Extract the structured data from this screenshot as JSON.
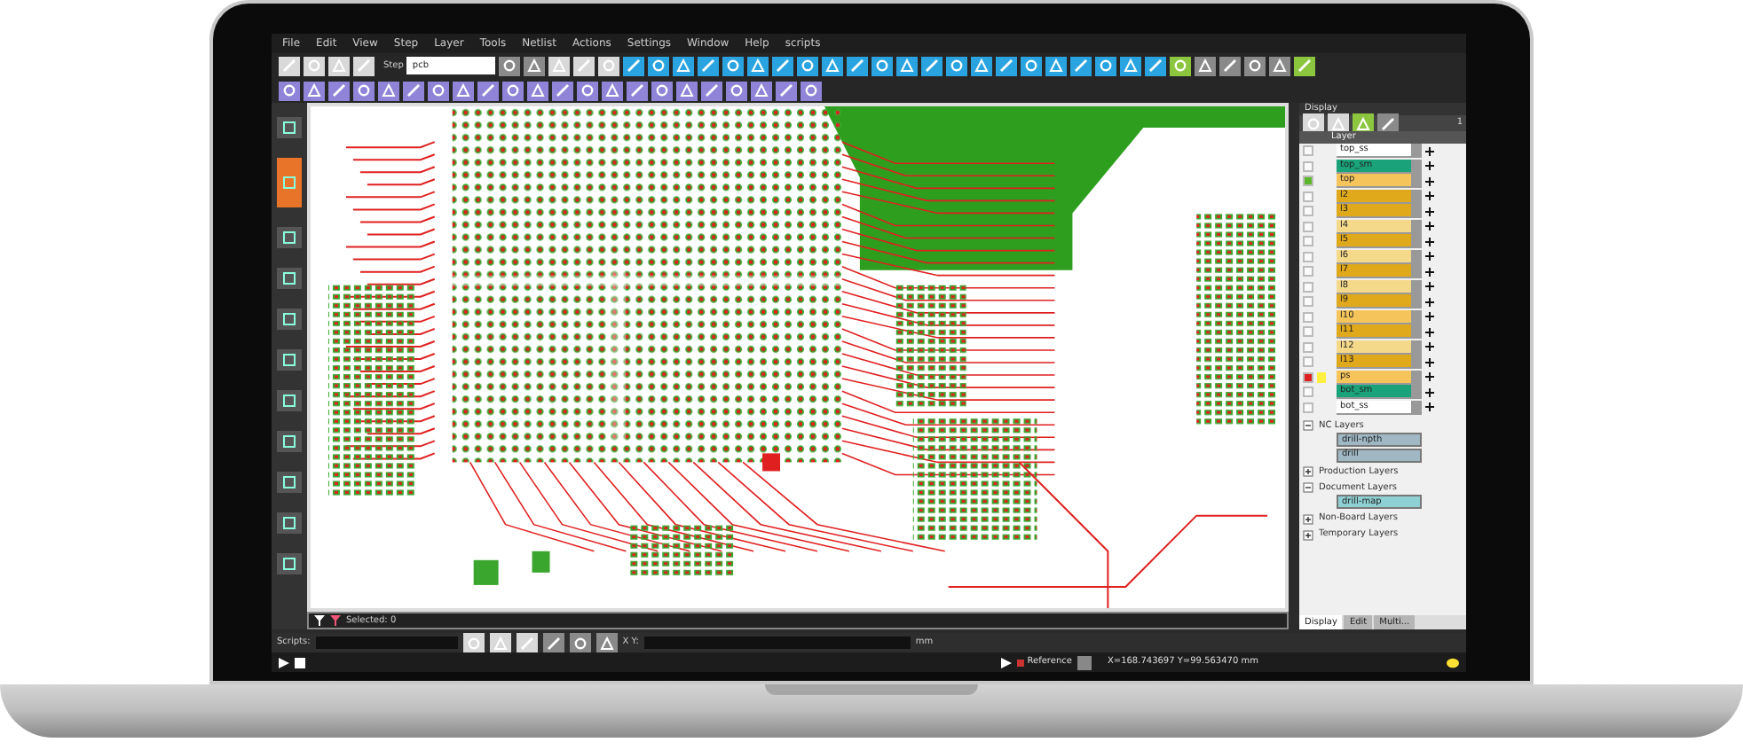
{
  "menu": [
    "File",
    "Edit",
    "View",
    "Step",
    "Layer",
    "Tools",
    "Netlist",
    "Actions",
    "Settings",
    "Window",
    "Help",
    "scripts"
  ],
  "step": {
    "label": "Step",
    "value": "pcb"
  },
  "left_toolbar": [
    {
      "selected": false
    },
    {
      "selected": true
    },
    {
      "selected": false
    },
    {
      "selected": false
    },
    {
      "selected": false
    },
    {
      "selected": false
    },
    {
      "selected": false
    },
    {
      "selected": false
    },
    {
      "selected": false
    },
    {
      "selected": false
    },
    {
      "selected": false
    }
  ],
  "panel": {
    "title": "Display",
    "layer_header": "Layer",
    "count": "1",
    "layers": [
      {
        "name": "top_ss",
        "color": "#ffffff",
        "work": false,
        "affected": false
      },
      {
        "name": "top_sm",
        "color": "#1aa37a",
        "work": false,
        "affected": false
      },
      {
        "name": "top",
        "color": "#f5c45a",
        "work": true,
        "affected": false
      },
      {
        "name": "l2",
        "color": "#e0a91c",
        "work": false,
        "affected": false
      },
      {
        "name": "l3",
        "color": "#e0a91c",
        "work": false,
        "affected": false
      },
      {
        "name": "l4",
        "color": "#f5d98a",
        "work": false,
        "affected": false
      },
      {
        "name": "l5",
        "color": "#e0a91c",
        "work": false,
        "affected": false
      },
      {
        "name": "l6",
        "color": "#f5d98a",
        "work": false,
        "affected": false
      },
      {
        "name": "l7",
        "color": "#e0a91c",
        "work": false,
        "affected": false
      },
      {
        "name": "l8",
        "color": "#f5d98a",
        "work": false,
        "affected": false
      },
      {
        "name": "l9",
        "color": "#e0a91c",
        "work": false,
        "affected": false
      },
      {
        "name": "l10",
        "color": "#f5c45a",
        "work": false,
        "affected": false
      },
      {
        "name": "l11",
        "color": "#e0a91c",
        "work": false,
        "affected": false
      },
      {
        "name": "l12",
        "color": "#f5d98a",
        "work": false,
        "affected": false
      },
      {
        "name": "l13",
        "color": "#e0a91c",
        "work": false,
        "affected": false
      },
      {
        "name": "ps",
        "color": "#f5c45a",
        "work": false,
        "affected": true
      },
      {
        "name": "bot_sm",
        "color": "#1aa37a",
        "work": false,
        "affected": false
      },
      {
        "name": "bot_ss",
        "color": "#ffffff",
        "work": false,
        "affected": false
      }
    ],
    "groups": [
      {
        "name": "NC Layers",
        "expanded": true,
        "children": [
          {
            "name": "drill-npth",
            "color": "#9fb8c4"
          },
          {
            "name": "drill",
            "color": "#9fb8c4"
          }
        ]
      },
      {
        "name": "Production Layers",
        "expanded": false
      },
      {
        "name": "Document Layers",
        "expanded": true,
        "children": [
          {
            "name": "drill-map",
            "color": "#8fd0d4"
          }
        ]
      },
      {
        "name": "Non-Board Layers",
        "expanded": false
      },
      {
        "name": "Temporary Layers",
        "expanded": false
      }
    ],
    "tabs": [
      {
        "label": "Display",
        "selected": true
      },
      {
        "label": "Edit",
        "selected": false
      },
      {
        "label": "Multi...",
        "selected": false
      }
    ]
  },
  "selection": {
    "text": "Selected: 0"
  },
  "scripts": {
    "label": "Scripts:",
    "xy_label": "X Y:",
    "unit": "mm"
  },
  "status": {
    "reference": "Reference",
    "coords": "X=168.743697 Y=99.563470 mm"
  }
}
